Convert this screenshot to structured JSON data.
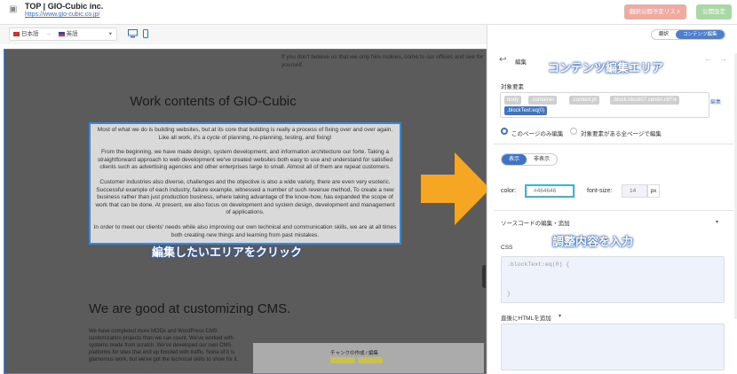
{
  "header": {
    "site_title": "TOP | GIO-Cubic inc.",
    "site_url": "https://www.gio-cubic.co.jp/",
    "publish_list_label": "翻訳公開予定リスト",
    "publish_label": "公開設定"
  },
  "language_bar": {
    "source_lang": "日本語",
    "arrow": "→",
    "target_lang": "英語"
  },
  "preview": {
    "top_text": "If you don't believe us that we only hire rookies, come to our offices and see for yourself.",
    "heading": "Work contents of GIO-Cubic",
    "paragraphs": [
      "Most of what we do is building websites, but at its core that building is really a process of fixing over and over again. Like all work, it's a cycle of planning, re-planning, testing, and fixing!",
      "From the beginning, we have made design, system development, and information architecture our forte. Taking a straightforward approach to web development we've created websites both easy to use and understand for satisfied clients such as advertising agencies and other enterprises large to small. Almost all of them are repeat customers.",
      "Customer industries also diverse, challenges and the objective is also a wide variety, there are even very esoteric. Successful example of each industry, failure example, witnessed a number of such revenue method, To create a new business rather than just production business, where taking advantage of the know-how, has expanded the scope of work that can be done. At present, we also focus on development and system design, development and management of applications.",
      "In order to meet our clients' needs while also improving our own technical and communication skills, we are at all times both creating new things and learning from past mistakes."
    ],
    "click_label": "編集したいエリアをクリック",
    "heading2": "We are good at customizing CMS.",
    "body2": "We have completed more MODx and WordPress CMS customization projects than we can count. We've worked with systems made from scratch. We've developed our own CMS platforms for sites that end up flooded with traffic. None of it is glamorous work, but we've got the technical skills to show for it.",
    "shot_row": "チャンクの作成 / 編集"
  },
  "panel": {
    "tab_translate": "翻訳",
    "tab_content_edit": "コンテンツ編集",
    "edit_label": "編集",
    "callout_area": "コンテンツ編集エリア",
    "target_elements_label": "対象要素",
    "chips": [
      "body",
      ".container",
      ".content.pt",
      ".block.block07.center.clrFix",
      ".blockText:eq(0)"
    ],
    "chip_edit": "編集",
    "radio_this_page": "このページのみ編集",
    "radio_all_pages": "対象要素がある全ページで編集",
    "toggle_show": "表示",
    "toggle_hide": "非表示",
    "color_label": "color:",
    "color_placeholder": "#464646",
    "font_size_label": "font-size:",
    "font_size_placeholder": "14",
    "font_size_unit": "px",
    "source_code_label": "ソースコードの編集・追加",
    "callout_input": "調整内容を入力",
    "css_label": "CSS",
    "css_line1": ".blockText:eq(0) {",
    "css_line2": "}",
    "html_after_label": "直後にHTMLを追加"
  },
  "colors": {
    "accent": "#3f73c4",
    "arrow": "#f5a623",
    "preview_bg": "#5b5b5b"
  }
}
